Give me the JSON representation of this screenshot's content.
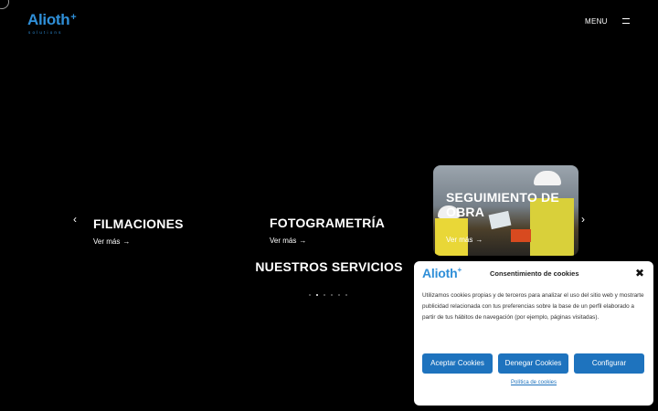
{
  "header": {
    "logo_text": "Alioth",
    "logo_plus": "+",
    "logo_sub": "solutions",
    "menu_label": "MENU"
  },
  "carousel": {
    "prev": "‹",
    "next": "›",
    "slides": [
      {
        "title": "FILMACIONES",
        "more": "Ver más",
        "arrow": "→"
      },
      {
        "title": "FOTOGRAMETRÍA",
        "more": "Ver más",
        "arrow": "→"
      },
      {
        "title": "SEGUIMIENTO DE OBRA",
        "more": "Ver más",
        "arrow": "→"
      }
    ],
    "pager_active_index": 1,
    "pager_count": 6
  },
  "section": {
    "title": "NUESTROS SERVICIOS"
  },
  "cookie_banner": {
    "logo_text": "Alioth",
    "logo_plus": "+",
    "title": "Consentimiento de cookies",
    "close": "✖",
    "text": "Utilizamos cookies propias y de terceros para analizar el uso del sitio web y mostrarte publicidad relacionada con tus preferencias sobre la base de un perfil elaborado a partir de tus hábitos de navegación (por ejemplo, páginas visitadas).",
    "accept": "Aceptar Cookies",
    "deny": "Denegar Cookies",
    "configure": "Configurar",
    "policy": "Política de cookies"
  },
  "colors": {
    "background": "#000000",
    "brand_blue": "#2f8fd8",
    "button_blue": "#1e73be"
  }
}
